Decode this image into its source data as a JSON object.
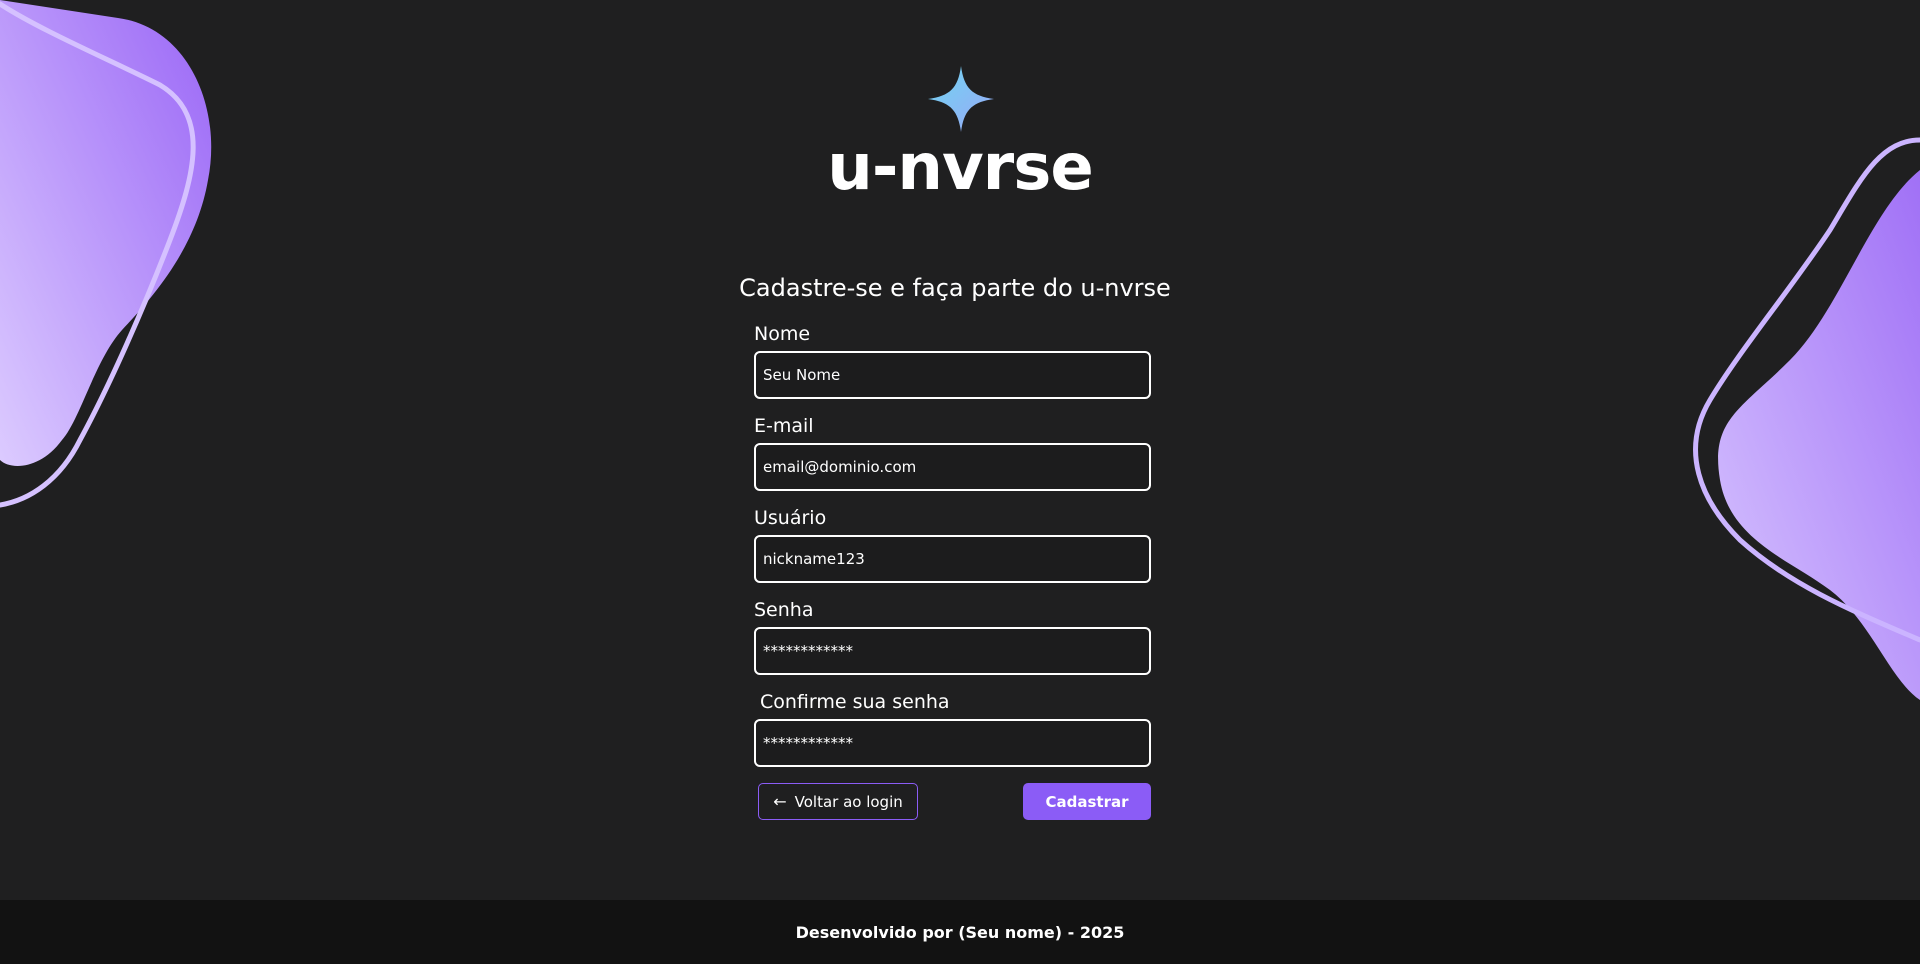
{
  "brand": {
    "name": "u-nvrse",
    "star_icon": "four-point-star-icon",
    "star_gradient": [
      "#6fd6f0",
      "#9aa8f8"
    ]
  },
  "heading": "Cadastre-se e faça parte do u-nvrse",
  "form": {
    "fields": [
      {
        "label": "Nome",
        "value": "Seu Nome",
        "type": "text"
      },
      {
        "label": "E-mail",
        "value": "email@dominio.com",
        "type": "email"
      },
      {
        "label": "Usuário",
        "value": "nickname123",
        "type": "text"
      },
      {
        "label": "Senha",
        "value": "************",
        "type": "password"
      },
      {
        "label": "Confirme sua senha",
        "value": "************",
        "type": "password"
      }
    ],
    "back_label": "Voltar ao login",
    "back_icon": "arrow-left-icon",
    "submit_label": "Cadastrar"
  },
  "footer": {
    "text": "Desenvolvido por (Seu nome) - 2025"
  },
  "colors": {
    "background": "#1f1f20",
    "accent": "#8b5cf6",
    "blob_light": "#d9c6ff",
    "blob_dark": "#9b6bf7",
    "footer_bg": "#121212"
  }
}
